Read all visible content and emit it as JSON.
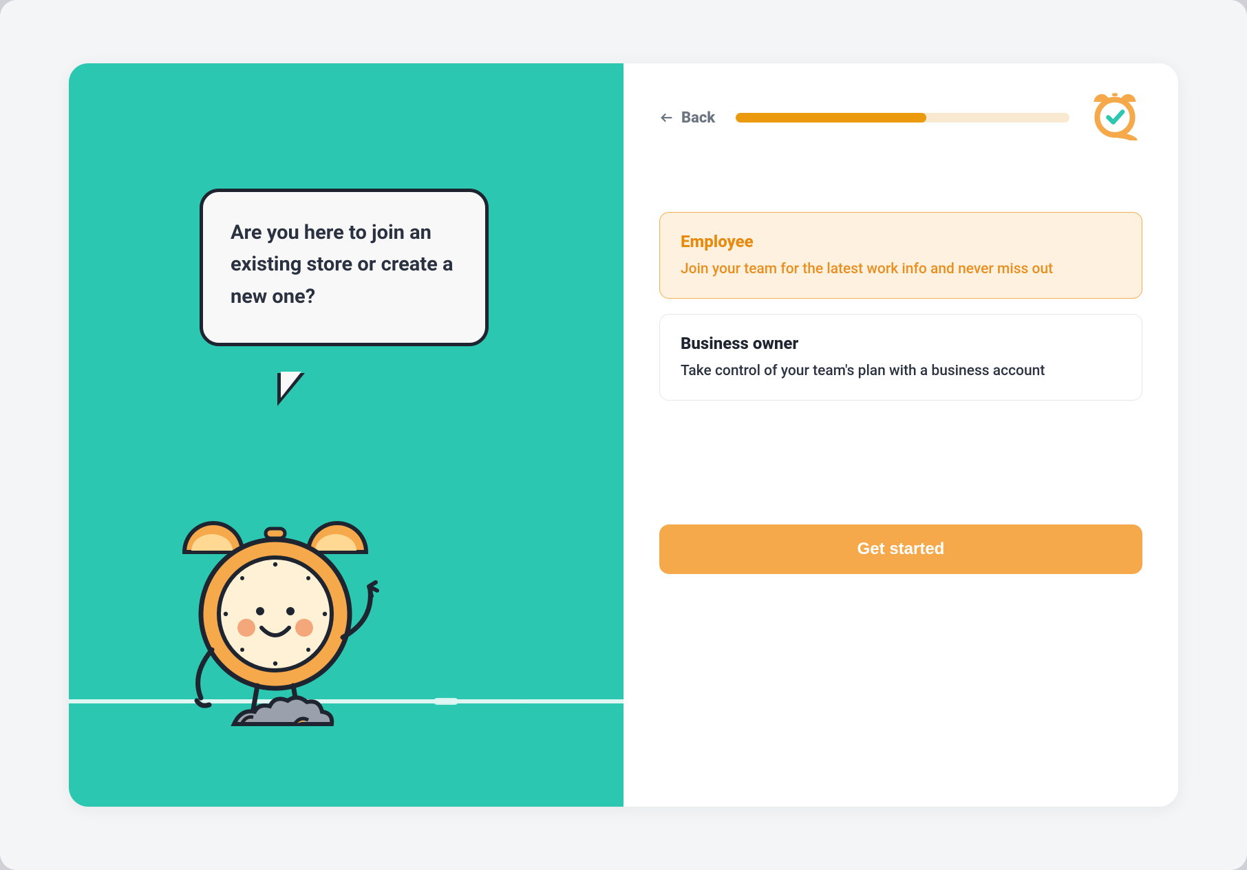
{
  "speech_text": "Are you here to join an existing store or create a new one?",
  "back_label": "Back",
  "progress_percent": 57,
  "options": [
    {
      "title": "Employee",
      "description": "Join your team for the latest work info and never miss out",
      "selected": true
    },
    {
      "title": "Business owner",
      "description": "Take control of your team's plan with a business account",
      "selected": false
    }
  ],
  "cta_label": "Get started",
  "colors": {
    "accent_orange": "#f6a94a",
    "accent_orange_dark": "#ea9a0c",
    "teal": "#2cc7b0",
    "text_dark": "#1f2530"
  }
}
